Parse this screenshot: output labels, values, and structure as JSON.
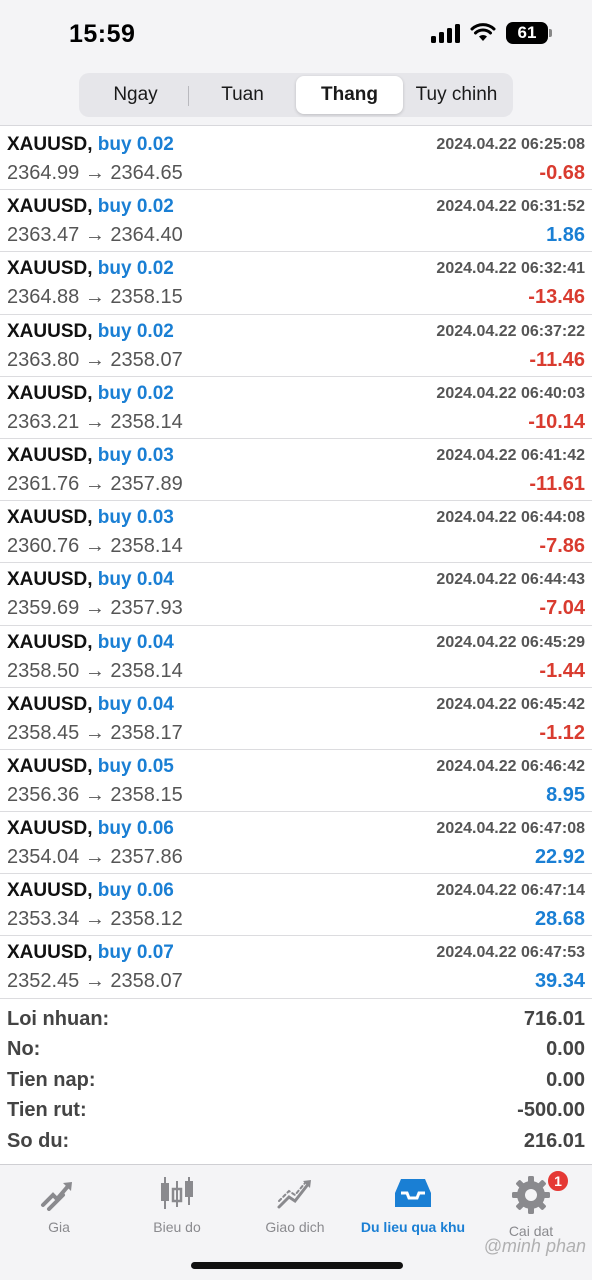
{
  "status_bar": {
    "time": "15:59",
    "battery": "61"
  },
  "tabs": [
    {
      "label": "Ngay"
    },
    {
      "label": "Tuan"
    },
    {
      "label": "Thang",
      "active": true
    },
    {
      "label": "Tuy chinh"
    }
  ],
  "trades": [
    {
      "symbol": "XAUUSD,",
      "action": "buy 0.02",
      "time": "2024.04.22 06:25:08",
      "prices": "2364.99 → 2364.65",
      "profit": "-0.68"
    },
    {
      "symbol": "XAUUSD,",
      "action": "buy 0.02",
      "time": "2024.04.22 06:31:52",
      "prices": "2363.47 → 2364.40",
      "profit": "1.86"
    },
    {
      "symbol": "XAUUSD,",
      "action": "buy 0.02",
      "time": "2024.04.22 06:32:41",
      "prices": "2364.88 → 2358.15",
      "profit": "-13.46"
    },
    {
      "symbol": "XAUUSD,",
      "action": "buy 0.02",
      "time": "2024.04.22 06:37:22",
      "prices": "2363.80 → 2358.07",
      "profit": "-11.46"
    },
    {
      "symbol": "XAUUSD,",
      "action": "buy 0.02",
      "time": "2024.04.22 06:40:03",
      "prices": "2363.21 → 2358.14",
      "profit": "-10.14"
    },
    {
      "symbol": "XAUUSD,",
      "action": "buy 0.03",
      "time": "2024.04.22 06:41:42",
      "prices": "2361.76 → 2357.89",
      "profit": "-11.61"
    },
    {
      "symbol": "XAUUSD,",
      "action": "buy 0.03",
      "time": "2024.04.22 06:44:08",
      "prices": "2360.76 → 2358.14",
      "profit": "-7.86"
    },
    {
      "symbol": "XAUUSD,",
      "action": "buy 0.04",
      "time": "2024.04.22 06:44:43",
      "prices": "2359.69 → 2357.93",
      "profit": "-7.04"
    },
    {
      "symbol": "XAUUSD,",
      "action": "buy 0.04",
      "time": "2024.04.22 06:45:29",
      "prices": "2358.50 → 2358.14",
      "profit": "-1.44"
    },
    {
      "symbol": "XAUUSD,",
      "action": "buy 0.04",
      "time": "2024.04.22 06:45:42",
      "prices": "2358.45 → 2358.17",
      "profit": "-1.12"
    },
    {
      "symbol": "XAUUSD,",
      "action": "buy 0.05",
      "time": "2024.04.22 06:46:42",
      "prices": "2356.36 → 2358.15",
      "profit": "8.95"
    },
    {
      "symbol": "XAUUSD,",
      "action": "buy 0.06",
      "time": "2024.04.22 06:47:08",
      "prices": "2354.04 → 2357.86",
      "profit": "22.92"
    },
    {
      "symbol": "XAUUSD,",
      "action": "buy 0.06",
      "time": "2024.04.22 06:47:14",
      "prices": "2353.34 → 2358.12",
      "profit": "28.68"
    },
    {
      "symbol": "XAUUSD,",
      "action": "buy 0.07",
      "time": "2024.04.22 06:47:53",
      "prices": "2352.45 → 2358.07",
      "profit": "39.34"
    }
  ],
  "summary": [
    {
      "label": "Loi nhuan:",
      "value": "716.01"
    },
    {
      "label": "No:",
      "value": "0.00"
    },
    {
      "label": "Tien nap:",
      "value": "0.00"
    },
    {
      "label": "Tien rut:",
      "value": "-500.00"
    },
    {
      "label": "So du:",
      "value": "216.01"
    }
  ],
  "tabbar": [
    {
      "label": "Gia",
      "icon": "quotes-arrows-icon"
    },
    {
      "label": "Bieu do",
      "icon": "candlestick-chart-icon"
    },
    {
      "label": "Giao dich",
      "icon": "trade-chart-icon"
    },
    {
      "label": "Du lieu qua khu",
      "icon": "history-inbox-icon",
      "active": true
    },
    {
      "label": "Cai dat",
      "icon": "settings-gear-icon",
      "badge": "1"
    }
  ],
  "watermark": "@minh phan",
  "colors": {
    "accent": "#1a7fd4",
    "loss": "#d93b2f",
    "inactive": "#8a8a8e"
  }
}
